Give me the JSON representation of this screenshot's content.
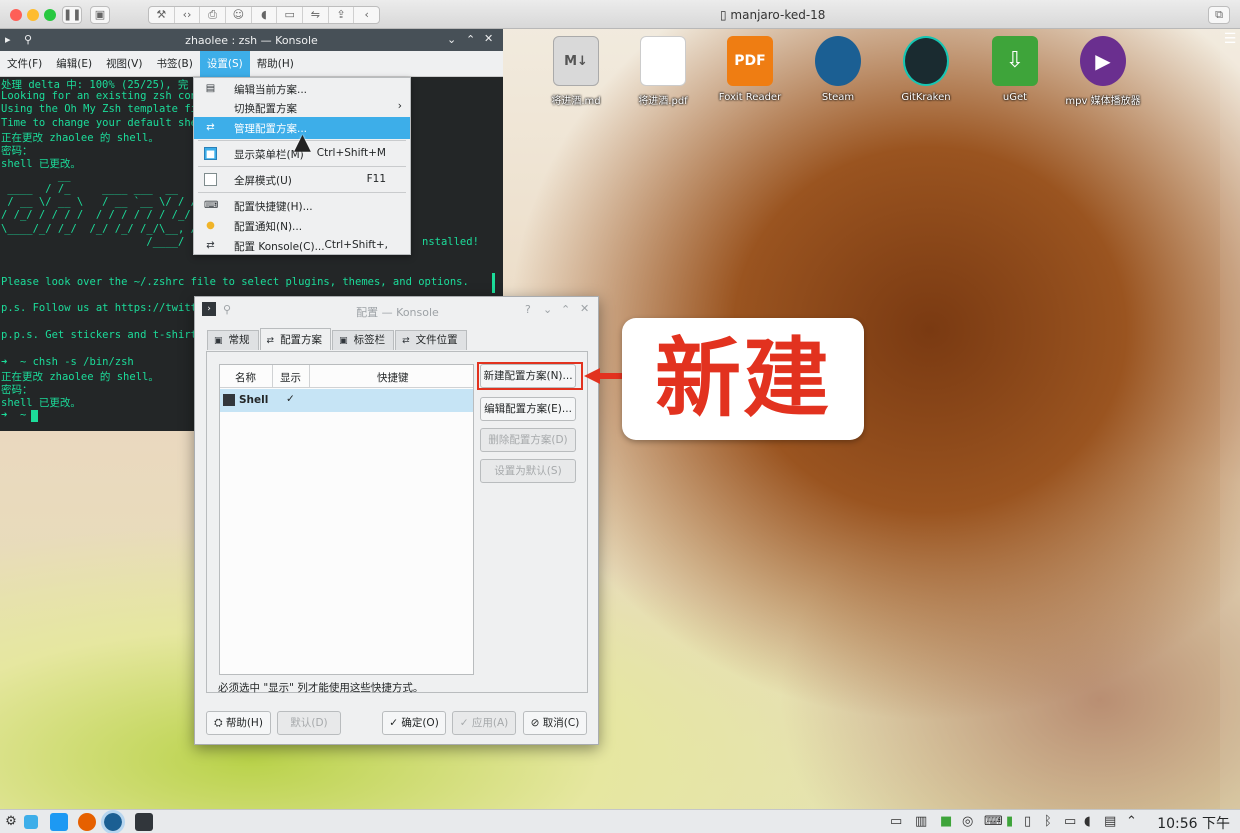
{
  "host": {
    "title": "manjaro-ked-18"
  },
  "konsole": {
    "title": "zhaolee : zsh — Konsole",
    "menubar": [
      "文件(F)",
      "编辑(E)",
      "视图(V)",
      "书签(B)",
      "设置(S)",
      "帮助(H)"
    ],
    "terminal_lines": [
      "处理 delta 中: 100% (25/25), 完",
      "Looking for an existing zsh con",
      "Using the Oh My Zsh template fi",
      "Time to change your default she",
      "正在更改 zhaolee 的 shell。",
      "密码：",
      "shell 已更改。",
      "         __",
      " ____  / /_     ____ ___  __",
      " / __ \\/ __ \\   / __ `__ \\/ / /",
      "/ /_/ / / / /  / / / / / / /_/",
      "\\____/_/ /_/  /_/ /_/ /_/\\__, /",
      "                       /____/",
      "",
      "Please look over the ~/.zshrc file to select plugins, themes, and options.",
      "",
      "p.s. Follow us at https://twitt",
      "",
      "p.p.s. Get stickers and t-shirt",
      "",
      "➜  ~ chsh -s /bin/zsh",
      "正在更改 zhaolee 的 shell。",
      "密码：",
      "shell 已更改。",
      "➜  ~ "
    ],
    "installed_fragment": "nstalled!"
  },
  "settings_menu": {
    "items": [
      {
        "label": "编辑当前方案...",
        "shortcut": "",
        "icon": "edit-profile-icon"
      },
      {
        "label": "切换配置方案",
        "shortcut": "",
        "icon": "",
        "submenu": true
      },
      {
        "label": "管理配置方案...",
        "shortcut": "",
        "icon": "manage-profiles-icon"
      },
      {
        "label": "显示菜单栏(M)",
        "shortcut": "Ctrl+Shift+M",
        "icon": "checkbox-checked"
      },
      {
        "label": "全屏模式(U)",
        "shortcut": "F11",
        "icon": "checkbox"
      },
      {
        "label": "配置快捷键(H)...",
        "shortcut": "",
        "icon": "keyboard-icon"
      },
      {
        "label": "配置通知(N)...",
        "shortcut": "",
        "icon": "notification-icon"
      },
      {
        "label": "配置 Konsole(C)...",
        "shortcut": "Ctrl+Shift+,",
        "icon": "configure-icon"
      }
    ]
  },
  "desktop_icons": [
    {
      "label": "将进酒.md",
      "color": "#d9d9d9"
    },
    {
      "label": "将进酒.pdf",
      "color": "#ffffff"
    },
    {
      "label": "Foxit Reader",
      "color": "#ef7d12"
    },
    {
      "label": "Steam",
      "color": "#1b5f93"
    },
    {
      "label": "GitKraken",
      "color": "#1a2b30"
    },
    {
      "label": "uGet",
      "color": "#3ea43a"
    },
    {
      "label": "mpv 媒体播放器",
      "color": "#6a2f8f"
    }
  ],
  "dialog": {
    "title": "配置 — Konsole",
    "tabs": [
      "常规",
      "配置方案",
      "标签栏",
      "文件位置"
    ],
    "columns": [
      "名称",
      "显示",
      "快捷键"
    ],
    "profiles": [
      {
        "name": "Shell",
        "show": "✓"
      }
    ],
    "side_buttons": [
      "新建配置方案(N)...",
      "编辑配置方案(E)...",
      "删除配置方案(D)",
      "设置为默认(S)"
    ],
    "hint": "必须选中 \"显示\" 列才能使用这些快捷方式。",
    "footer": {
      "help": "帮助(H)",
      "defaults": "默认(D)",
      "ok": "确定(O)",
      "apply": "应用(A)",
      "cancel": "取消(C)"
    }
  },
  "annotation": {
    "text": "新建",
    "color": "#e2321f"
  },
  "taskbar": {
    "clock": "10:56 下午"
  }
}
